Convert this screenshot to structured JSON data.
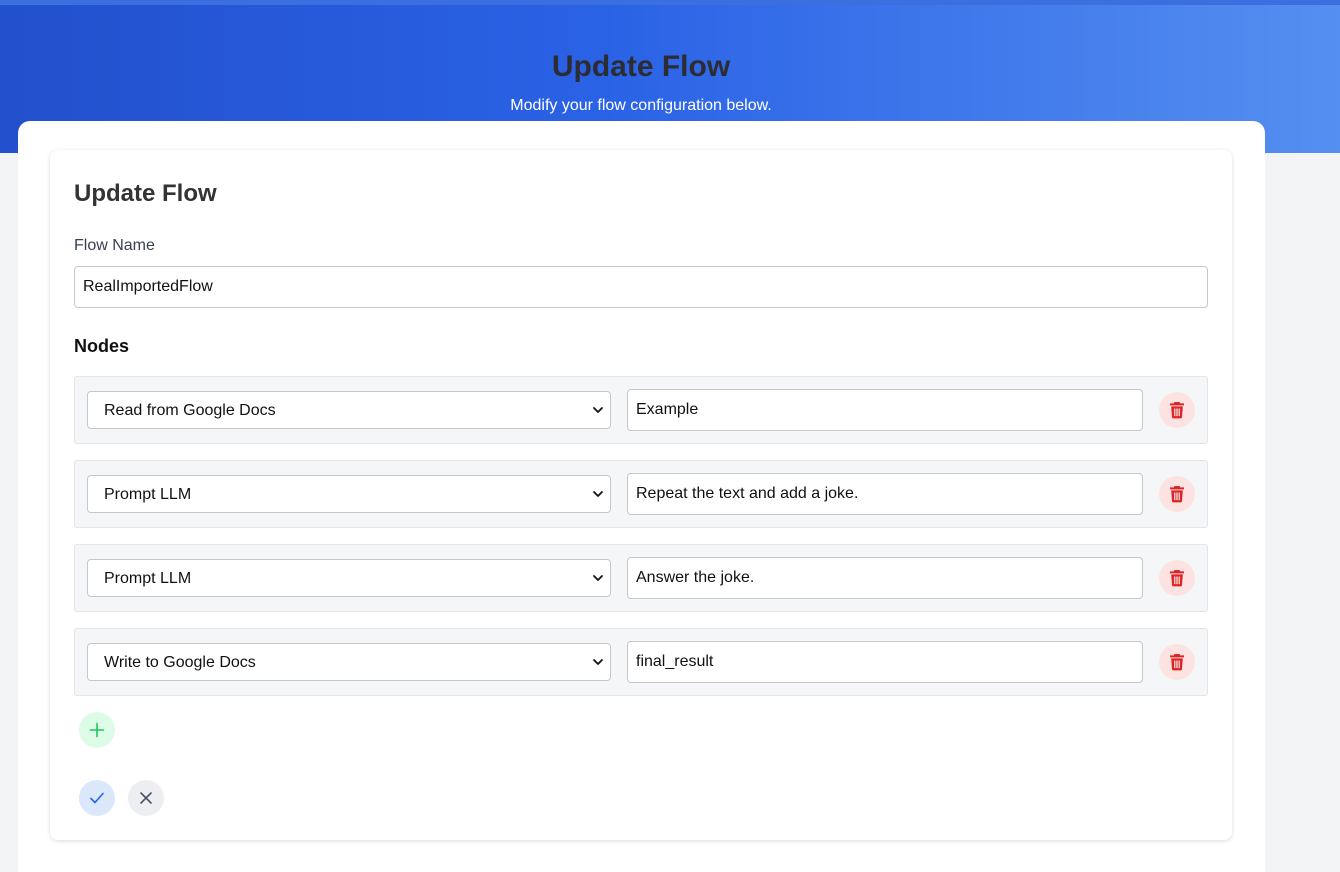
{
  "header": {
    "title": "Update Flow",
    "subtitle": "Modify your flow configuration below."
  },
  "form": {
    "title": "Update Flow",
    "flow_name_label": "Flow Name",
    "flow_name_value": "RealImportedFlow",
    "nodes_heading": "Nodes",
    "nodes": [
      {
        "type": "Read from Google Docs",
        "value": "Example"
      },
      {
        "type": "Prompt LLM",
        "value": "Repeat the text and add a joke."
      },
      {
        "type": "Prompt LLM",
        "value": "Answer the joke."
      },
      {
        "type": "Write to Google Docs",
        "value": "final_result"
      }
    ]
  },
  "icons": {
    "delete": "trash-icon",
    "add": "plus-icon",
    "save": "check-icon",
    "cancel": "close-icon",
    "select": "chevron-down-icon"
  },
  "colors": {
    "header_gradient_start": "#2350cc",
    "header_gradient_end": "#558ff0",
    "delete_icon": "#dc2626",
    "delete_bg": "#fde2e2",
    "add_icon": "#22c55e",
    "add_bg": "#dcfce7",
    "save_icon": "#2563eb",
    "save_bg": "#dbe7fb",
    "cancel_icon": "#4b5563",
    "cancel_bg": "#eceef1"
  }
}
